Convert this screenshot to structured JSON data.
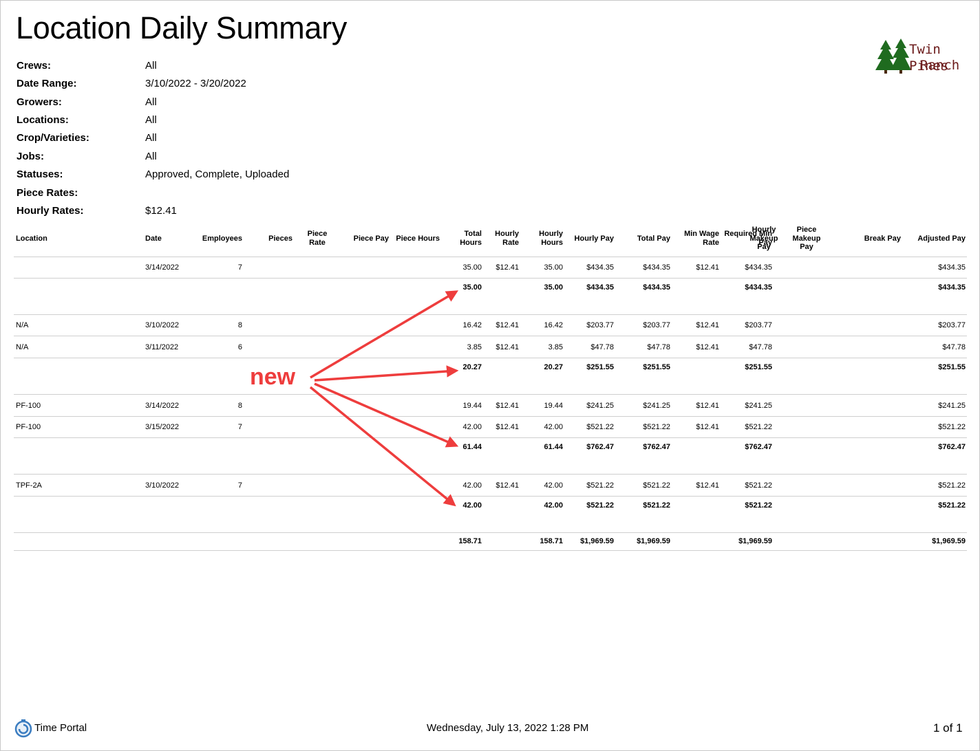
{
  "title": "Location Daily Summary",
  "logo": {
    "line1": "Twin Pines",
    "line2": "Ranch",
    "icon": "pine-trees-icon",
    "color": "#6b1a1a",
    "tree_color": "#1f6b1f"
  },
  "filters": [
    {
      "label": "Crews:",
      "value": "All"
    },
    {
      "label": "Date Range:",
      "value": "3/10/2022 - 3/20/2022"
    },
    {
      "label": "Growers:",
      "value": "All"
    },
    {
      "label": "Locations:",
      "value": "All"
    },
    {
      "label": "Crop/Varieties:",
      "value": "All"
    },
    {
      "label": "Jobs:",
      "value": "All"
    },
    {
      "label": "Statuses:",
      "value": "Approved, Complete, Uploaded"
    },
    {
      "label": "Piece Rates:",
      "value": ""
    },
    {
      "label": "Hourly Rates:",
      "value": "$12.41"
    }
  ],
  "columns": [
    [
      "Location"
    ],
    [
      "Date"
    ],
    [
      "Employees"
    ],
    [
      "Pieces"
    ],
    [
      "Piece",
      "Rate"
    ],
    [
      "Piece Pay"
    ],
    [
      "Piece Hours"
    ],
    [
      "Total",
      "Hours"
    ],
    [
      "Hourly",
      "Rate"
    ],
    [
      "Hourly",
      "Hours"
    ],
    [
      "Hourly Pay"
    ],
    [
      "Total Pay"
    ],
    [
      "Min Wage",
      "Rate"
    ],
    [
      "Required Min",
      "Pay"
    ],
    [
      "Hourly",
      "Makeup",
      "Pay"
    ],
    [
      "Piece",
      "Makeup",
      "Pay"
    ],
    [
      "Break Pay"
    ],
    [
      "Adjusted Pay"
    ]
  ],
  "groups": [
    {
      "rows": [
        {
          "location": "",
          "date": "3/14/2022",
          "employees": "7",
          "total_hours": "35.00",
          "hourly_rate": "$12.41",
          "hourly_hours": "35.00",
          "hourly_pay": "$434.35",
          "total_pay": "$434.35",
          "min_wage_rate": "$12.41",
          "required_min_pay": "$434.35",
          "adjusted_pay": "$434.35"
        }
      ],
      "subtotal": {
        "total_hours": "35.00",
        "hourly_hours": "35.00",
        "hourly_pay": "$434.35",
        "total_pay": "$434.35",
        "required_min_pay": "$434.35",
        "adjusted_pay": "$434.35"
      }
    },
    {
      "rows": [
        {
          "location": "N/A",
          "date": "3/10/2022",
          "employees": "8",
          "total_hours": "16.42",
          "hourly_rate": "$12.41",
          "hourly_hours": "16.42",
          "hourly_pay": "$203.77",
          "total_pay": "$203.77",
          "min_wage_rate": "$12.41",
          "required_min_pay": "$203.77",
          "adjusted_pay": "$203.77"
        },
        {
          "location": "N/A",
          "date": "3/11/2022",
          "employees": "6",
          "total_hours": "3.85",
          "hourly_rate": "$12.41",
          "hourly_hours": "3.85",
          "hourly_pay": "$47.78",
          "total_pay": "$47.78",
          "min_wage_rate": "$12.41",
          "required_min_pay": "$47.78",
          "adjusted_pay": "$47.78"
        }
      ],
      "subtotal": {
        "total_hours": "20.27",
        "hourly_hours": "20.27",
        "hourly_pay": "$251.55",
        "total_pay": "$251.55",
        "required_min_pay": "$251.55",
        "adjusted_pay": "$251.55"
      }
    },
    {
      "rows": [
        {
          "location": "PF-100",
          "date": "3/14/2022",
          "employees": "8",
          "total_hours": "19.44",
          "hourly_rate": "$12.41",
          "hourly_hours": "19.44",
          "hourly_pay": "$241.25",
          "total_pay": "$241.25",
          "min_wage_rate": "$12.41",
          "required_min_pay": "$241.25",
          "adjusted_pay": "$241.25"
        },
        {
          "location": "PF-100",
          "date": "3/15/2022",
          "employees": "7",
          "total_hours": "42.00",
          "hourly_rate": "$12.41",
          "hourly_hours": "42.00",
          "hourly_pay": "$521.22",
          "total_pay": "$521.22",
          "min_wage_rate": "$12.41",
          "required_min_pay": "$521.22",
          "adjusted_pay": "$521.22"
        }
      ],
      "subtotal": {
        "total_hours": "61.44",
        "hourly_hours": "61.44",
        "hourly_pay": "$762.47",
        "total_pay": "$762.47",
        "required_min_pay": "$762.47",
        "adjusted_pay": "$762.47"
      }
    },
    {
      "rows": [
        {
          "location": "TPF-2A",
          "date": "3/10/2022",
          "employees": "7",
          "total_hours": "42.00",
          "hourly_rate": "$12.41",
          "hourly_hours": "42.00",
          "hourly_pay": "$521.22",
          "total_pay": "$521.22",
          "min_wage_rate": "$12.41",
          "required_min_pay": "$521.22",
          "adjusted_pay": "$521.22"
        }
      ],
      "subtotal": {
        "total_hours": "42.00",
        "hourly_hours": "42.00",
        "hourly_pay": "$521.22",
        "total_pay": "$521.22",
        "required_min_pay": "$521.22",
        "adjusted_pay": "$521.22"
      }
    }
  ],
  "grand_total": {
    "total_hours": "158.71",
    "hourly_hours": "158.71",
    "hourly_pay": "$1,969.59",
    "total_pay": "$1,969.59",
    "required_min_pay": "$1,969.59",
    "adjusted_pay": "$1,969.59"
  },
  "annotation": {
    "text": "new",
    "color": "#ee3d3d"
  },
  "footer": {
    "app": "Time Portal",
    "app_icon": "time-portal-logo-icon",
    "datetime": "Wednesday, July 13, 2022 1:28 PM",
    "page": "1 of 1"
  }
}
